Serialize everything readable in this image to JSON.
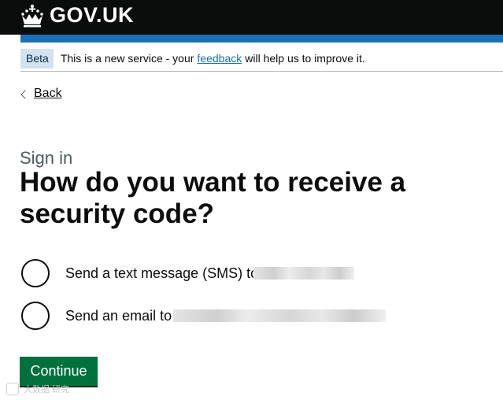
{
  "header": {
    "logo_text": "GOV.UK",
    "brand_color": "#0b0c0c",
    "accent_color": "#1d70b8"
  },
  "beta_banner": {
    "tag": "Beta",
    "text_before": "This is a new service - your",
    "link_text": "feedback",
    "text_after": "will help us to improve it."
  },
  "back_link": {
    "label": "Back",
    "icon": "chevron-left-icon"
  },
  "page": {
    "caption": "Sign in",
    "heading": "How do you want to receive a security code?"
  },
  "options": [
    {
      "label": "Send a text message (SMS) to",
      "selected": false
    },
    {
      "label": "Send an email to",
      "selected": false
    }
  ],
  "continue_button": {
    "label": "Continue",
    "color": "#00703c"
  },
  "watermark": {
    "text": "大数据 研究"
  }
}
